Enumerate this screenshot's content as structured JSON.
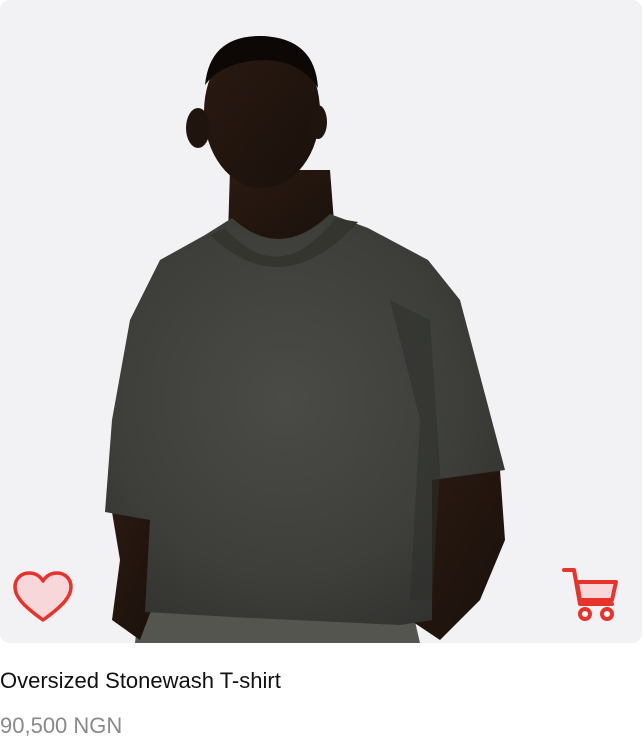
{
  "product": {
    "name": "Oversized Stonewash T-shirt",
    "price": "90,500 NGN",
    "image_alt": "Model wearing oversized stonewash t-shirt"
  },
  "actions": {
    "wishlist_icon": "heart-icon",
    "cart_icon": "cart-icon"
  },
  "colors": {
    "accent": "#e8332b",
    "accent_fill": "#f7d7d9",
    "title": "#111111",
    "price": "#8a8a8a",
    "image_bg": "#f2f2f4",
    "shirt": "#3f403d"
  }
}
